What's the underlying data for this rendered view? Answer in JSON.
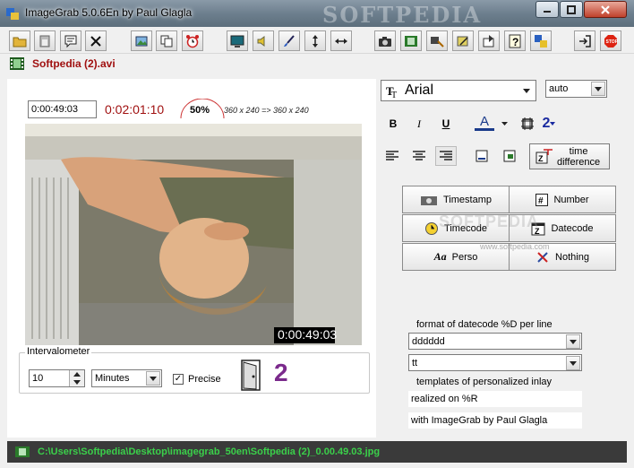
{
  "window": {
    "title": "ImageGrab 5.0.6En by Paul Glagla",
    "watermark": "SOFTPEDIA"
  },
  "toolbar": {
    "buttons": [
      "open-folder-icon",
      "paste-icon",
      "comment-icon",
      "close-x-icon",
      "add-image-icon",
      "copy-icon",
      "alarm-clock-icon",
      "monitor-icon",
      "speaker-icon",
      "brush-icon",
      "flip-vertical-icon",
      "flip-horizontal-icon",
      "camera-icon",
      "film-frames-icon",
      "frame-tool-icon",
      "edit-frame-icon",
      "save-frame-icon",
      "help-icon",
      "puzzle-icon",
      "exit-icon",
      "stop-icon"
    ]
  },
  "file": {
    "name": "Softpedia (2).avi"
  },
  "player": {
    "position": "0:00:49:03",
    "duration": "0:02:01:10",
    "zoom": "50%",
    "dimensions": "360 x 240  =>  360 x 240",
    "overlay_timestamp": "0:00:49:03"
  },
  "intervalometer": {
    "legend": "Intervalometer",
    "value": "10",
    "unit": "Minutes",
    "precise_label": "Precise",
    "precise_checked": true,
    "count": "2"
  },
  "text_format": {
    "font": "Arial",
    "size": "auto",
    "bold": "B",
    "italic": "I",
    "underline": "U",
    "color_glyph": "A",
    "frame_level": "2",
    "time_difference": "time\ndifference"
  },
  "stamps": {
    "timestamp": "Timestamp",
    "number": "Number",
    "timecode": "Timecode",
    "datecode": "Datecode",
    "perso": "Perso",
    "nothing": "Nothing"
  },
  "datecode": {
    "format_label": "format of datecode %D per line",
    "line1": "dddddd",
    "line2": "tt"
  },
  "templates": {
    "label": "templates of personalized inlay",
    "line1": "realized on %R",
    "line2": "with ImageGrab by Paul Glagla"
  },
  "watermark_right": {
    "text": "SOFTPEDIA",
    "url": "www.softpedia.com"
  },
  "status": {
    "path": "C:\\Users\\Softpedia\\Desktop\\imagegrab_50en\\Softpedia (2)_0.00.49.03.jpg"
  },
  "colors": {
    "duration": "#a01010",
    "count": "#7b2a8c",
    "status_text": "#3ad04a"
  }
}
